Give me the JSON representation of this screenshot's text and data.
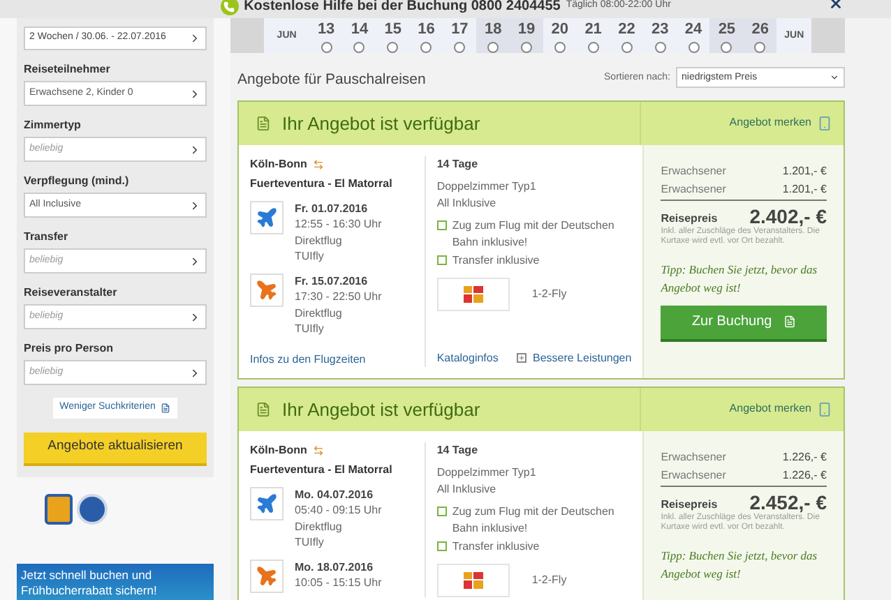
{
  "topbar": {
    "title": "Kostenlose Hilfe bei der Buchung 0800 2404455",
    "hours": "Täglich 08:00-22:00 Uhr"
  },
  "calendar": {
    "month_start": "JUN",
    "month_end": "JUN",
    "days": [
      {
        "day": "13",
        "weekend": false
      },
      {
        "day": "14",
        "weekend": false
      },
      {
        "day": "15",
        "weekend": false
      },
      {
        "day": "16",
        "weekend": false
      },
      {
        "day": "17",
        "weekend": false
      },
      {
        "day": "18",
        "weekend": true
      },
      {
        "day": "19",
        "weekend": true
      },
      {
        "day": "20",
        "weekend": false
      },
      {
        "day": "21",
        "weekend": false
      },
      {
        "day": "22",
        "weekend": false
      },
      {
        "day": "23",
        "weekend": false
      },
      {
        "day": "24",
        "weekend": false
      },
      {
        "day": "25",
        "weekend": true
      },
      {
        "day": "26",
        "weekend": true
      }
    ]
  },
  "sidebar": {
    "period": "2 Wochen / 30.06. - 22.07.2016",
    "filters": [
      {
        "label": "Reiseteilnehmer",
        "value": "Erwachsene 2, Kinder 0"
      },
      {
        "label": "Zimmertyp",
        "placeholder": "beliebig"
      },
      {
        "label": "Verpflegung (mind.)",
        "value": "All Inclusive"
      },
      {
        "label": "Transfer",
        "placeholder": "beliebig"
      },
      {
        "label": "Reiseveranstalter",
        "placeholder": "beliebig"
      },
      {
        "label": "Preis pro Person",
        "placeholder": "beliebig"
      }
    ],
    "less_link": "Weniger Suchkriterien",
    "update_button": "Angebote aktualisieren",
    "banner": "Jetzt schnell buchen und Frühbucherrabatt sichern!"
  },
  "heading": "Angebote für Pauschalreisen",
  "sort": {
    "label": "Sortieren nach:",
    "value": "niedrigstem Preis"
  },
  "offers": [
    {
      "status": "Ihr Angebot ist verfügbar",
      "save": "Angebot merken",
      "origin": "Köln-Bonn",
      "destination": "Fuerteventura - El Matorral",
      "flights": [
        {
          "kind": "outbound",
          "date": "Fr. 01.07.2016",
          "time": "12:55 - 16:30 Uhr",
          "type": "Direktflug",
          "airline": "TUIfly"
        },
        {
          "kind": "return",
          "date": "Fr. 15.07.2016",
          "time": "17:30 - 22:50 Uhr",
          "type": "Direktflug",
          "airline": "TUIfly"
        }
      ],
      "flight_info": "Infos zu den Flugzeiten",
      "duration": "14 Tage",
      "room": "Doppelzimmer Typ1",
      "board": "All Inklusive",
      "extras": [
        "Zug zum Flug mit der Deutschen Bahn inklusive!",
        "Transfer inklusive"
      ],
      "operator": "1-2-Fly",
      "catalog": "Kataloginfos",
      "better": "Bessere Leistungen",
      "prices": [
        {
          "label": "Erwachsener",
          "amount": "1.201,- €"
        },
        {
          "label": "Erwachsener",
          "amount": "1.201,- €"
        }
      ],
      "total_label": "Reisepreis",
      "total": "2.402,- €",
      "note": "Inkl. aller Zuschläge des Veranstalters. Die Kurtaxe wird evtl. vor Ort bezahlt.",
      "tip": "Tipp: Buchen Sie jetzt, bevor das Angebot weg ist!",
      "book": "Zur Buchung"
    },
    {
      "status": "Ihr Angebot ist verfügbar",
      "save": "Angebot merken",
      "origin": "Köln-Bonn",
      "destination": "Fuerteventura - El Matorral",
      "flights": [
        {
          "kind": "outbound",
          "date": "Mo. 04.07.2016",
          "time": "05:40 - 09:15 Uhr",
          "type": "Direktflug",
          "airline": "TUIfly"
        },
        {
          "kind": "return",
          "date": "Mo. 18.07.2016",
          "time": "10:05 - 15:15 Uhr"
        }
      ],
      "duration": "14 Tage",
      "room": "Doppelzimmer Typ1",
      "board": "All Inklusive",
      "extras": [
        "Zug zum Flug mit der Deutschen Bahn inklusive!",
        "Transfer inklusive"
      ],
      "operator": "1-2-Fly",
      "prices": [
        {
          "label": "Erwachsener",
          "amount": "1.226,- €"
        },
        {
          "label": "Erwachsener",
          "amount": "1.226,- €"
        }
      ],
      "total_label": "Reisepreis",
      "total": "2.452,- €",
      "note": "Inkl. aller Zuschläge des Veranstalters. Die Kurtaxe wird evtl. vor Ort bezahlt.",
      "tip": "Tipp: Buchen Sie jetzt, bevor das Angebot weg ist!"
    }
  ]
}
